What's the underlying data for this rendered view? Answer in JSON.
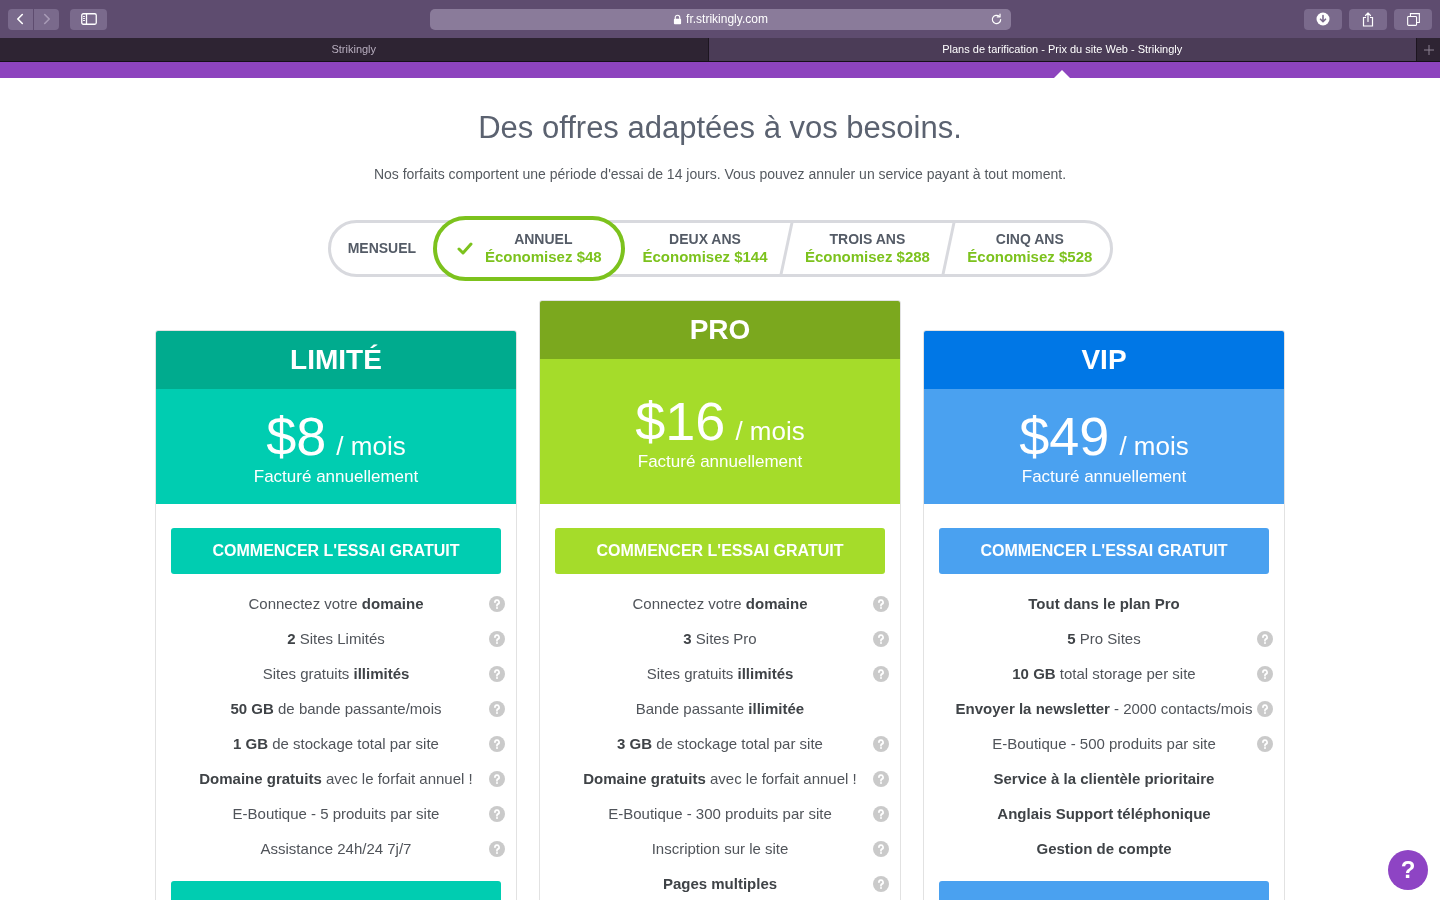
{
  "browser": {
    "url": "fr.strikingly.com",
    "tabs": [
      {
        "title": "Strikingly",
        "selected": false
      },
      {
        "title": "Plans de tarification - Prix du site Web - Strikingly",
        "selected": true
      }
    ]
  },
  "heading": "Des offres adaptées à vos besoins.",
  "subheading": "Nos forfaits comportent une période d'essai de 14 jours. Vous pouvez annuler un service payant à tout moment.",
  "billing_periods": [
    {
      "label": "MENSUEL",
      "selected": false
    },
    {
      "label": "ANNUEL",
      "savings": "Économisez $48",
      "selected": true
    },
    {
      "label": "DEUX ANS",
      "savings": "Économisez $144",
      "selected": false
    },
    {
      "label": "TROIS ANS",
      "savings": "Économisez $288",
      "selected": false
    },
    {
      "label": "CINQ ANS",
      "savings": "Économisez $528",
      "selected": false
    }
  ],
  "plans": [
    {
      "header": {
        "title": "LIMITÉ",
        "color": "#00ab8e"
      },
      "color": "#00cdb1",
      "featured": false,
      "price": "$8",
      "unit": "/ mois",
      "billing": "Facturé annuellement",
      "cta": "COMMENCER L'ESSAI GRATUIT",
      "features": [
        {
          "text": "Connectez votre **domaine**",
          "bold": false,
          "help": true
        },
        {
          "text": "**2** Sites Limités",
          "bold": false,
          "help": true
        },
        {
          "text": "Sites gratuits **illimités**",
          "bold": false,
          "help": true
        },
        {
          "text": "**50 GB** de bande passante/mois",
          "bold": false,
          "help": true
        },
        {
          "text": "**1 GB** de stockage total par site",
          "bold": false,
          "help": true
        },
        {
          "text": "**Domaine gratuits** avec le forfait annuel !",
          "bold": false,
          "help": true
        },
        {
          "text": "E-Boutique - 5 produits par site",
          "bold": false,
          "help": true
        },
        {
          "text": "Assistance 24h/24 7j/7",
          "bold": false,
          "help": true
        }
      ],
      "bottom_button": true
    },
    {
      "header": {
        "title": "PRO",
        "color": "#7ba81e"
      },
      "color": "#a5dc2a",
      "featured": true,
      "price": "$16",
      "unit": "/ mois",
      "billing": "Facturé annuellement",
      "cta": "COMMENCER L'ESSAI GRATUIT",
      "features": [
        {
          "text": "Connectez votre **domaine**",
          "bold": false,
          "help": true
        },
        {
          "text": "**3** Sites Pro",
          "bold": false,
          "help": true
        },
        {
          "text": "Sites gratuits **illimités**",
          "bold": false,
          "help": true
        },
        {
          "text": "Bande passante **illimitée**",
          "bold": false,
          "help": false
        },
        {
          "text": "**3 GB** de stockage total par site",
          "bold": false,
          "help": true
        },
        {
          "text": "**Domaine gratuits** avec le forfait annuel !",
          "bold": false,
          "help": true
        },
        {
          "text": "E-Boutique - 300 produits par site",
          "bold": false,
          "help": true
        },
        {
          "text": "Inscription sur le site",
          "bold": false,
          "help": true
        },
        {
          "text": "Pages multiples",
          "bold": true,
          "help": true
        }
      ],
      "bottom_button": false
    },
    {
      "header": {
        "title": "VIP",
        "color": "#0077e6"
      },
      "color": "#4aa1f0",
      "featured": false,
      "price": "$49",
      "unit": "/ mois",
      "billing": "Facturé annuellement",
      "cta": "COMMENCER L'ESSAI GRATUIT",
      "features": [
        {
          "text": "Tout dans le plan Pro",
          "bold": true,
          "help": false
        },
        {
          "text": "**5** Pro Sites",
          "bold": false,
          "help": true
        },
        {
          "text": "**10 GB** total storage per site",
          "bold": false,
          "help": true
        },
        {
          "text": "**Envoyer la newsletter** - 2000 contacts/mois",
          "bold": false,
          "help": true
        },
        {
          "text": "E-Boutique - 500 produits par site",
          "bold": false,
          "help": true
        },
        {
          "text": "Service à la clientèle prioritaire",
          "bold": true,
          "help": false
        },
        {
          "text": "Anglais Support téléphonique",
          "bold": true,
          "help": false
        },
        {
          "text": "Gestion de compte",
          "bold": true,
          "help": false
        }
      ],
      "bottom_button": true
    }
  ],
  "help_button": "?"
}
